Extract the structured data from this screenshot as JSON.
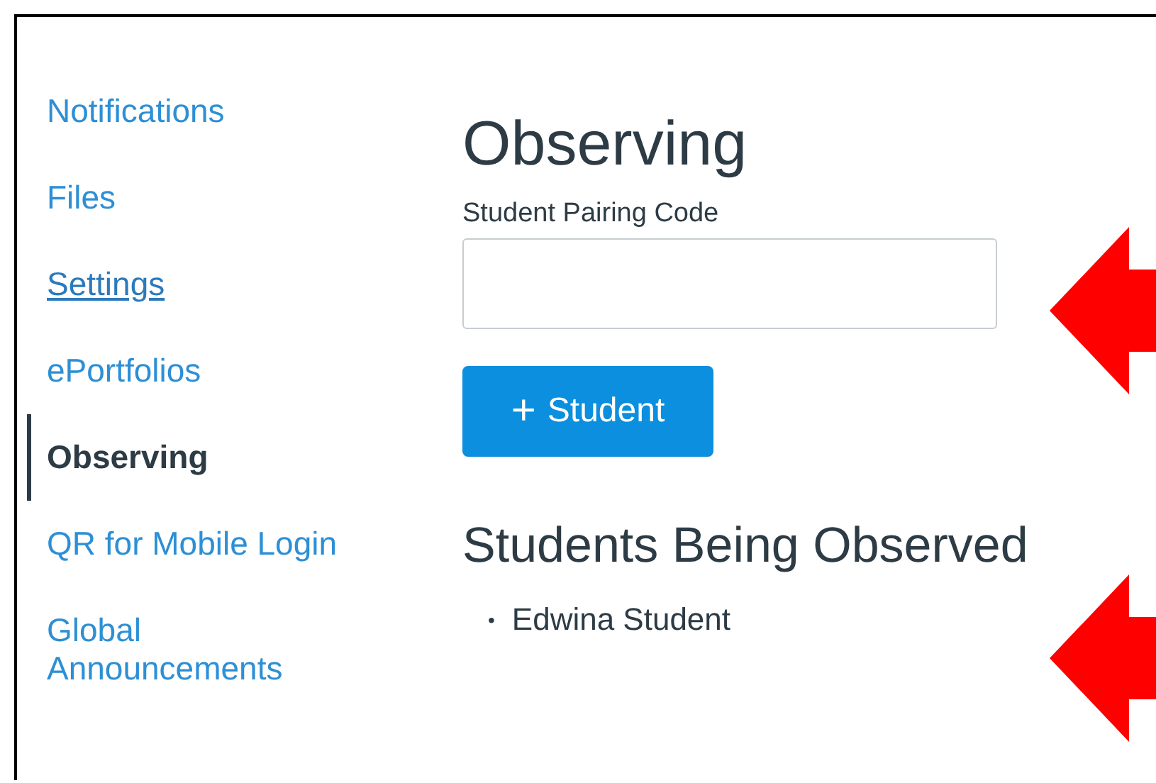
{
  "sidebar": {
    "items": [
      {
        "label": "Notifications",
        "selected": false,
        "hovered": false
      },
      {
        "label": "Files",
        "selected": false,
        "hovered": false
      },
      {
        "label": "Settings",
        "selected": false,
        "hovered": true
      },
      {
        "label": "ePortfolios",
        "selected": false,
        "hovered": false
      },
      {
        "label": "Observing",
        "selected": true,
        "hovered": false
      },
      {
        "label": "QR for Mobile Login",
        "selected": false,
        "hovered": false
      },
      {
        "label": "Global Announcements",
        "selected": false,
        "hovered": false
      }
    ]
  },
  "main": {
    "title": "Observing",
    "field": {
      "label": "Student Pairing Code"
    },
    "button": {
      "icon": "+",
      "label": "Student"
    },
    "section_title": "Students Being Observed",
    "students": [
      {
        "bullet": "•",
        "name": "Edwina Student"
      }
    ]
  },
  "callouts": [
    {
      "kind": "arrow"
    },
    {
      "kind": "arrow"
    }
  ]
}
